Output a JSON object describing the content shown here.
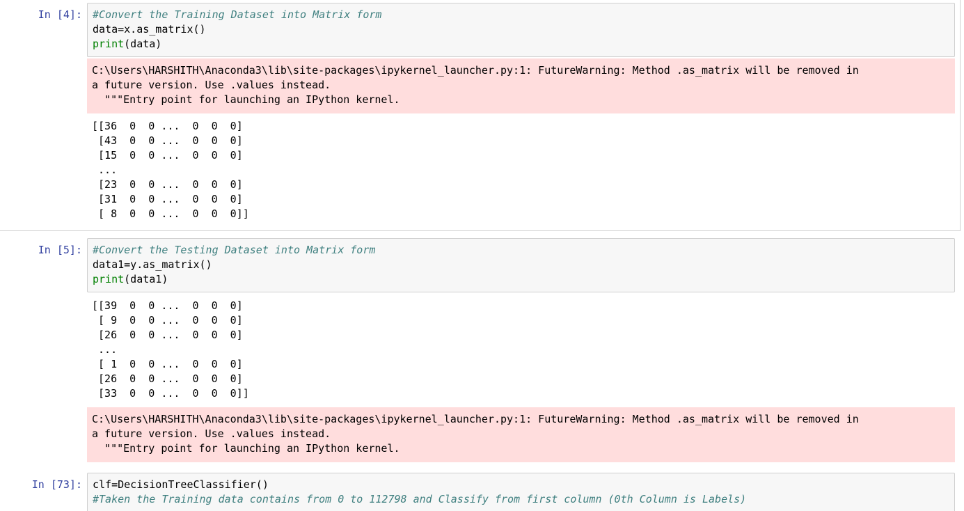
{
  "cells": [
    {
      "prompt": "In [4]:",
      "code": {
        "comment": "#Convert the Training Dataset into Matrix form",
        "line2": "data=x.as_matrix()",
        "print_kw": "print",
        "print_args": "(data)"
      },
      "warning": [
        "C:\\Users\\HARSHITH\\Anaconda3\\lib\\site-packages\\ipykernel_launcher.py:1: FutureWarning: Method .as_matrix will be removed in",
        "a future version. Use .values instead.",
        "  \"\"\"Entry point for launching an IPython kernel."
      ],
      "output": [
        "[[36  0  0 ...  0  0  0]",
        " [43  0  0 ...  0  0  0]",
        " [15  0  0 ...  0  0  0]",
        " ...",
        " [23  0  0 ...  0  0  0]",
        " [31  0  0 ...  0  0  0]",
        " [ 8  0  0 ...  0  0  0]]"
      ]
    },
    {
      "prompt": "In [5]:",
      "code": {
        "comment": "#Convert the Testing Dataset into Matrix form",
        "line2": "data1=y.as_matrix()",
        "print_kw": "print",
        "print_args": "(data1)"
      },
      "output": [
        "[[39  0  0 ...  0  0  0]",
        " [ 9  0  0 ...  0  0  0]",
        " [26  0  0 ...  0  0  0]",
        " ...",
        " [ 1  0  0 ...  0  0  0]",
        " [26  0  0 ...  0  0  0]",
        " [33  0  0 ...  0  0  0]]"
      ],
      "warning": [
        "C:\\Users\\HARSHITH\\Anaconda3\\lib\\site-packages\\ipykernel_launcher.py:1: FutureWarning: Method .as_matrix will be removed in",
        "a future version. Use .values instead.",
        "  \"\"\"Entry point for launching an IPython kernel."
      ]
    },
    {
      "prompt": "In [73]:",
      "code": {
        "line1": "clf=DecisionTreeClassifier()",
        "comment": "#Taken the Training data contains from 0 to 112798 and Classify from first column (0th Column is Labels)"
      }
    }
  ]
}
